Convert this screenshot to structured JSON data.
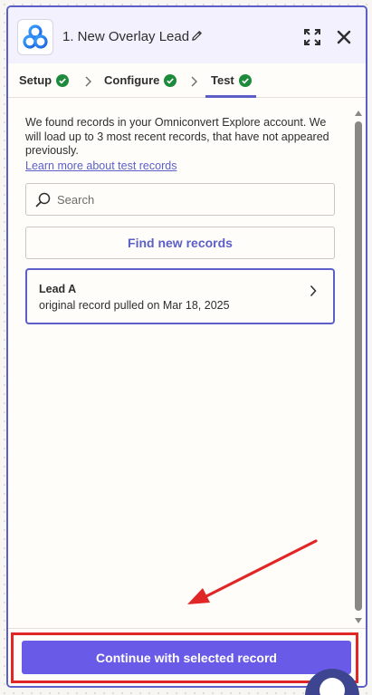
{
  "header": {
    "title": "1. New Overlay Lead",
    "app_icon": "omniconvert-logo-icon",
    "actions": [
      "pencil-icon",
      "expand-icon",
      "close-icon"
    ]
  },
  "tabs": [
    {
      "label": "Setup",
      "status": "complete"
    },
    {
      "label": "Configure",
      "status": "complete"
    },
    {
      "label": "Test",
      "status": "complete",
      "active": true
    }
  ],
  "test": {
    "intro": "We found records in your Omniconvert Explore account. We will load up to 3 most recent records, that have not appeared previously.",
    "learn_link": "Learn more about test records",
    "search_placeholder": "Search",
    "find_button": "Find new records",
    "records": [
      {
        "name": "Lead A",
        "meta": "original record pulled on Mar 18, 2025",
        "selected": true
      }
    ]
  },
  "footer": {
    "continue_button": "Continue with selected record"
  },
  "colors": {
    "accent": "#5b5fc7",
    "button": "#695be8",
    "success": "#1e8a3c",
    "annotation": "#e02626"
  }
}
